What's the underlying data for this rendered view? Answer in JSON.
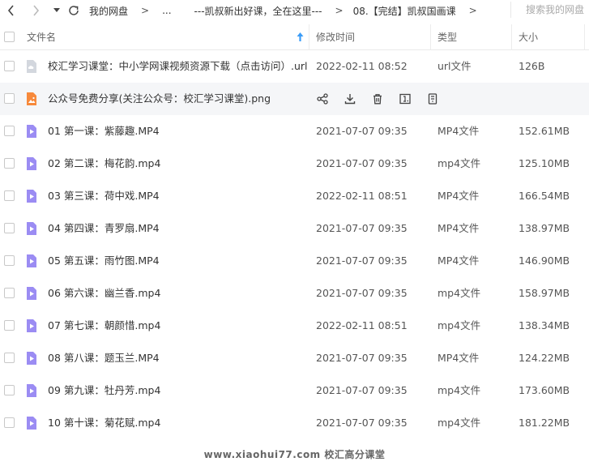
{
  "breadcrumb": {
    "root": "我的网盘",
    "ellipsis": "...",
    "parent": "---凯叔新出好课，全在这里---",
    "current": "08.【完结】凯叔国画课"
  },
  "search": {
    "placeholder": "搜索我的网盘"
  },
  "columns": {
    "name": "文件名",
    "modified": "修改时间",
    "type": "类型",
    "size": "大小"
  },
  "files": [
    {
      "name": "校汇学习课堂：中小学网课视频资源下载（点击访问）.url",
      "date": "2022-02-11 08:52",
      "type": "url文件",
      "size": "126B",
      "icon": "link-file-icon"
    },
    {
      "name": "公众号免费分享(关注公众号：校汇学习课堂).png",
      "date": "",
      "type": "",
      "size": "",
      "icon": "image-file-icon"
    },
    {
      "name": "01 第一课：紫藤趣.MP4",
      "date": "2021-07-07 09:35",
      "type": "MP4文件",
      "size": "152.61MB",
      "icon": "video-file-icon"
    },
    {
      "name": "02 第二课：梅花韵.mp4",
      "date": "2021-07-07 09:35",
      "type": "mp4文件",
      "size": "125.10MB",
      "icon": "video-file-icon"
    },
    {
      "name": "03 第三课：荷中戏.MP4",
      "date": "2022-02-11 08:51",
      "type": "MP4文件",
      "size": "166.54MB",
      "icon": "video-file-icon"
    },
    {
      "name": "04 第四课：青罗扇.MP4",
      "date": "2021-07-07 09:35",
      "type": "MP4文件",
      "size": "138.97MB",
      "icon": "video-file-icon"
    },
    {
      "name": "05 第五课：雨竹图.MP4",
      "date": "2021-07-07 09:35",
      "type": "MP4文件",
      "size": "146.90MB",
      "icon": "video-file-icon"
    },
    {
      "name": "06 第六课：幽兰香.mp4",
      "date": "2021-07-07 09:35",
      "type": "mp4文件",
      "size": "158.97MB",
      "icon": "video-file-icon"
    },
    {
      "name": "07 第七课：朝颜惜.mp4",
      "date": "2022-02-11 08:51",
      "type": "mp4文件",
      "size": "138.34MB",
      "icon": "video-file-icon"
    },
    {
      "name": "08 第八课：题玉兰.MP4",
      "date": "2021-07-07 09:35",
      "type": "MP4文件",
      "size": "124.22MB",
      "icon": "video-file-icon"
    },
    {
      "name": "09 第九课：牡丹芳.mp4",
      "date": "2021-07-07 09:35",
      "type": "mp4文件",
      "size": "173.60MB",
      "icon": "video-file-icon"
    },
    {
      "name": "10 第十课：菊花赋.mp4",
      "date": "2021-07-07 09:35",
      "type": "mp4文件",
      "size": "181.22MB",
      "icon": "video-file-icon"
    }
  ],
  "watermark": "www.xiaohui77.com  校汇高分课堂",
  "colors": {
    "video_icon": "#9b8cf3",
    "image_icon": "#f7893b",
    "link_icon": "#c9ced6",
    "sort_arrow": "#3b9cf7"
  }
}
